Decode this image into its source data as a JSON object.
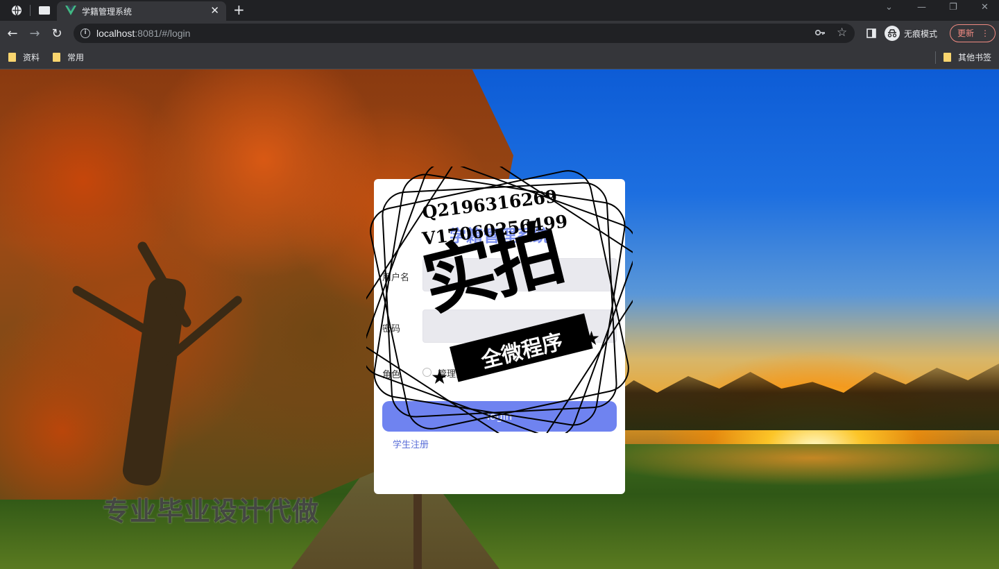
{
  "browser": {
    "tab_title": "学籍管理系统",
    "tab_close": "✕",
    "new_tab": "+",
    "url_host": "localhost",
    "url_rest": ":8081/#/login",
    "incognito_label": "无痕模式",
    "update_label": "更新",
    "bookmarks": [
      "资料",
      "常用"
    ],
    "other_bookmarks": "其他书签"
  },
  "login": {
    "title": "学籍管理系统",
    "username_label": "用户名",
    "password_label": "密码",
    "role_label": "角色",
    "role_option": "管理员",
    "login_button": "login",
    "register_link": "学生注册"
  },
  "watermark": {
    "stamp_line1": "Q2196316269",
    "stamp_line2": "V17060256499",
    "stamp_big": "实拍",
    "stamp_ribbon": "全微程序",
    "bottom_text": "专业毕业设计代做"
  },
  "colors": {
    "accent": "#6f83f0",
    "title": "#7b8ff0",
    "link": "#5b6fd8"
  }
}
